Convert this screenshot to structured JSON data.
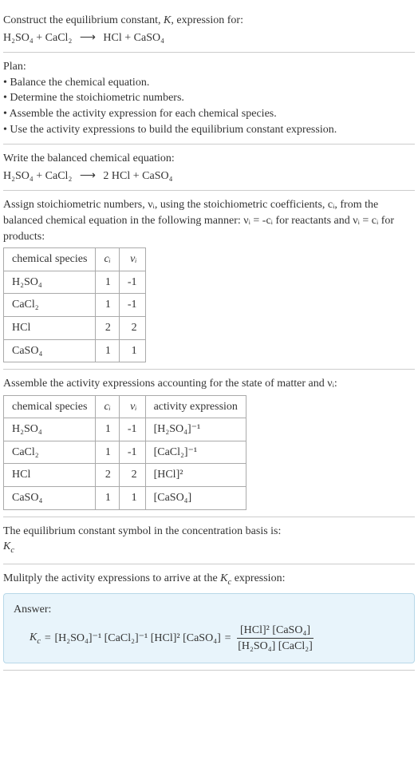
{
  "header": {
    "prompt": "Construct the equilibrium constant, K, expression for:",
    "equation_lhs": "H₂SO₄ + CaCl₂",
    "equation_rhs": "HCl + CaSO₄"
  },
  "plan": {
    "title": "Plan:",
    "items": [
      "Balance the chemical equation.",
      "Determine the stoichiometric numbers.",
      "Assemble the activity expression for each chemical species.",
      "Use the activity expressions to build the equilibrium constant expression."
    ]
  },
  "balanced": {
    "title": "Write the balanced chemical equation:",
    "equation_lhs": "H₂SO₄ + CaCl₂",
    "equation_rhs": "2 HCl + CaSO₄"
  },
  "stoich": {
    "intro_a": "Assign stoichiometric numbers, νᵢ, using the stoichiometric coefficients, cᵢ, from the balanced chemical equation in the following manner: νᵢ = -cᵢ for reactants and νᵢ = cᵢ for products:",
    "headers": {
      "species": "chemical species",
      "ci": "cᵢ",
      "vi": "νᵢ"
    },
    "rows": [
      {
        "species": "H₂SO₄",
        "ci": "1",
        "vi": "-1"
      },
      {
        "species": "CaCl₂",
        "ci": "1",
        "vi": "-1"
      },
      {
        "species": "HCl",
        "ci": "2",
        "vi": "2"
      },
      {
        "species": "CaSO₄",
        "ci": "1",
        "vi": "1"
      }
    ]
  },
  "activity": {
    "intro": "Assemble the activity expressions accounting for the state of matter and νᵢ:",
    "headers": {
      "species": "chemical species",
      "ci": "cᵢ",
      "vi": "νᵢ",
      "expr": "activity expression"
    },
    "rows": [
      {
        "species": "H₂SO₄",
        "ci": "1",
        "vi": "-1",
        "expr": "[H₂SO₄]⁻¹"
      },
      {
        "species": "CaCl₂",
        "ci": "1",
        "vi": "-1",
        "expr": "[CaCl₂]⁻¹"
      },
      {
        "species": "HCl",
        "ci": "2",
        "vi": "2",
        "expr": "[HCl]²"
      },
      {
        "species": "CaSO₄",
        "ci": "1",
        "vi": "1",
        "expr": "[CaSO₄]"
      }
    ]
  },
  "kc_symbol": {
    "line1": "The equilibrium constant symbol in the concentration basis is:",
    "line2": "K_c"
  },
  "multiply": {
    "intro": "Mulitply the activity expressions to arrive at the K_c expression:",
    "answer_label": "Answer:",
    "kc": "K_c",
    "eq": " = ",
    "flat": "[H₂SO₄]⁻¹ [CaCl₂]⁻¹ [HCl]² [CaSO₄]",
    "frac_num": "[HCl]² [CaSO₄]",
    "frac_den": "[H₂SO₄] [CaCl₂]"
  },
  "chart_data": {
    "type": "table",
    "tables": [
      {
        "title": "stoichiometric numbers",
        "columns": [
          "chemical species",
          "cᵢ",
          "νᵢ"
        ],
        "rows": [
          [
            "H₂SO₄",
            1,
            -1
          ],
          [
            "CaCl₂",
            1,
            -1
          ],
          [
            "HCl",
            2,
            2
          ],
          [
            "CaSO₄",
            1,
            1
          ]
        ]
      },
      {
        "title": "activity expressions",
        "columns": [
          "chemical species",
          "cᵢ",
          "νᵢ",
          "activity expression"
        ],
        "rows": [
          [
            "H₂SO₄",
            1,
            -1,
            "[H₂SO₄]⁻¹"
          ],
          [
            "CaCl₂",
            1,
            -1,
            "[CaCl₂]⁻¹"
          ],
          [
            "HCl",
            2,
            2,
            "[HCl]²"
          ],
          [
            "CaSO₄",
            1,
            1,
            "[CaSO₄]"
          ]
        ]
      }
    ]
  }
}
